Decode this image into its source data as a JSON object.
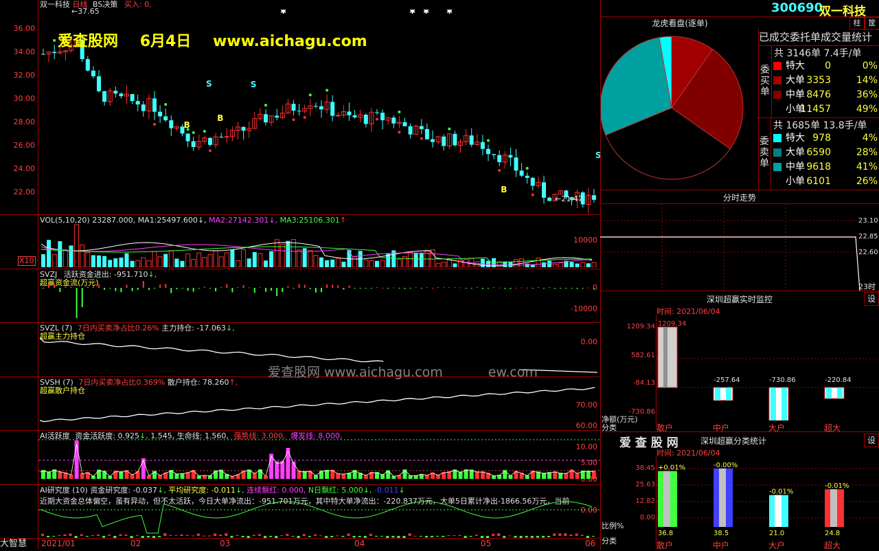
{
  "window": {
    "title": "双一科技",
    "period": "日线",
    "indicator": "BS决策",
    "signal_label": "买入:",
    "signal_value": "0,",
    "bottom_label": "大智慧"
  },
  "watermark": {
    "site_name": "爱查股网",
    "date": "6月4日",
    "url": "www.aichagu.com",
    "center_url": "爱查股网     www.aichagu.com",
    "center_url2": "ew.com"
  },
  "main_chart": {
    "y_ticks": [
      "36.00",
      "34.00",
      "32.00",
      "30.00",
      "28.00",
      "26.00",
      "24.00",
      "22.00"
    ],
    "high_marker": "37.65",
    "low_marker": "21.47",
    "bs_marks": [
      "B",
      "B",
      "B",
      "B",
      "S",
      "S",
      "S"
    ]
  },
  "x_axis": [
    "2021/01",
    "02",
    "03",
    "04",
    "05",
    "06"
  ],
  "vol_panel": {
    "name": "VOL(5,10,20)",
    "value": "23287.000",
    "ma1_label": "MA1:",
    "ma1": "25497.600",
    "ma2_label": "MA2:",
    "ma2": "27142.301",
    "ma3_label": "MA3:",
    "ma3": "25106.301",
    "y_tick": "10000",
    "unit": "X10"
  },
  "svzj_panel": {
    "name": "SVZJ",
    "label": "活跃资金进出:",
    "value": "-951.710",
    "subtitle": "超赢资金流(万元)",
    "y_ticks": [
      "0",
      "-10000"
    ]
  },
  "svzl_panel": {
    "name": "SVZL (7)",
    "label1": "7日内买卖净占比0.26%",
    "label2": "主力持仓:",
    "value": "-17.063",
    "subtitle": "超赢主力持仓",
    "y_tick": "0.00"
  },
  "svsh_panel": {
    "name": "SVSH (7)",
    "label1": "7日内买卖净占比0.369%",
    "label2": "散户持仓:",
    "value": "78.260",
    "subtitle": "超赢散户持仓",
    "y_ticks": [
      "70.00",
      "60.00"
    ]
  },
  "ai_panel": {
    "name": "AI活跃度",
    "label": "资金活跃度:",
    "v1": "0.925",
    "v2": "1.545,",
    "life_label": "生命线:",
    "life": "1.560,",
    "strong": "强势线: 3.000,",
    "burst": "爆发线: 8.000,",
    "y_ticks": [
      "10.00",
      "5.00",
      "0.00"
    ]
  },
  "research_panel": {
    "name": "AI研究度 (10)",
    "label": "资金研究度:",
    "v1": "-0.037",
    "flat_label": "平均研究度:",
    "flat": "-0.011",
    "lianxu": "连续飘红: 0.000,",
    "nday": "N日飘红: 5.000",
    "nval": "-0.011",
    "comment": "近期大资金总体偏空，虽有异动，但不太活跃，今日大单净流出：-951.701万元，其中特大单净流出：-220.837万元，大单5日累计净出-1866.56万元，当前",
    "y_tick": "0.00"
  },
  "right_panel": {
    "code": "300690",
    "name": "双一科技",
    "btn1": "柱",
    "btn2": "筐",
    "pie_title": "龙虎看盘(逐单)",
    "stat_title": "已成交委托单成交量统计",
    "buy_label": "委买单",
    "buy_total": "共 3146单 7.4手/单",
    "buy_rows": [
      {
        "name": "特大",
        "n": "0",
        "p": "0%",
        "color": "#ff0000"
      },
      {
        "name": "大单",
        "n": "3353",
        "p": "14%",
        "color": "#a00000"
      },
      {
        "name": "中单",
        "n": "8476",
        "p": "36%",
        "color": "#800000"
      },
      {
        "name": "小单",
        "n": "11457",
        "p": "49%",
        "color": "#000000"
      }
    ],
    "sell_label": "委卖单",
    "sell_total": "共 1685单 13.8手/单",
    "sell_rows": [
      {
        "name": "特大",
        "n": "978",
        "p": "4%",
        "color": "#00ffff"
      },
      {
        "name": "大单",
        "n": "6590",
        "p": "28%",
        "color": "#008080"
      },
      {
        "name": "中单",
        "n": "9618",
        "p": "41%",
        "color": "#00a0a0"
      },
      {
        "name": "小单",
        "n": "6101",
        "p": "26%",
        "color": "#000000"
      }
    ],
    "intraday_title": "分时走势",
    "intraday_ticks": [
      "23.10",
      "22.85",
      "22.60",
      "23时"
    ],
    "monitor_title": "深圳超赢实时监控",
    "monitor_btn": "设",
    "monitor_time": "时间: 2021/06/04",
    "monitor_ticks": [
      "1209.34",
      "582.61",
      "-84.13",
      "-730.86"
    ],
    "monitor_unit": "净额(万元)",
    "monitor_cat": "分类",
    "monitor_cats": [
      "散户",
      "中户",
      "大户",
      "超大"
    ],
    "monitor_values": [
      "1209.34",
      "-257.64",
      "-730.86",
      "-220.84"
    ],
    "stats_logo": "爱 查 股 网",
    "stats_title": "深圳超赢分类统计",
    "stats_btn": "设",
    "stats_time": "时间: 2021/06/04",
    "stats_ticks": [
      "38.45",
      "25.63",
      "12.82",
      "0.00"
    ],
    "stats_unit": "比例%",
    "stats_cat": "分类",
    "stats_cats": [
      "散户",
      "中户",
      "大户",
      "超大"
    ],
    "stats_top": [
      "+0.01%",
      "-0.00%",
      "-0.01%",
      "-0.01%"
    ],
    "stats_bottom": [
      "36.8",
      "38.5",
      "21.0",
      "24.8"
    ]
  }
}
